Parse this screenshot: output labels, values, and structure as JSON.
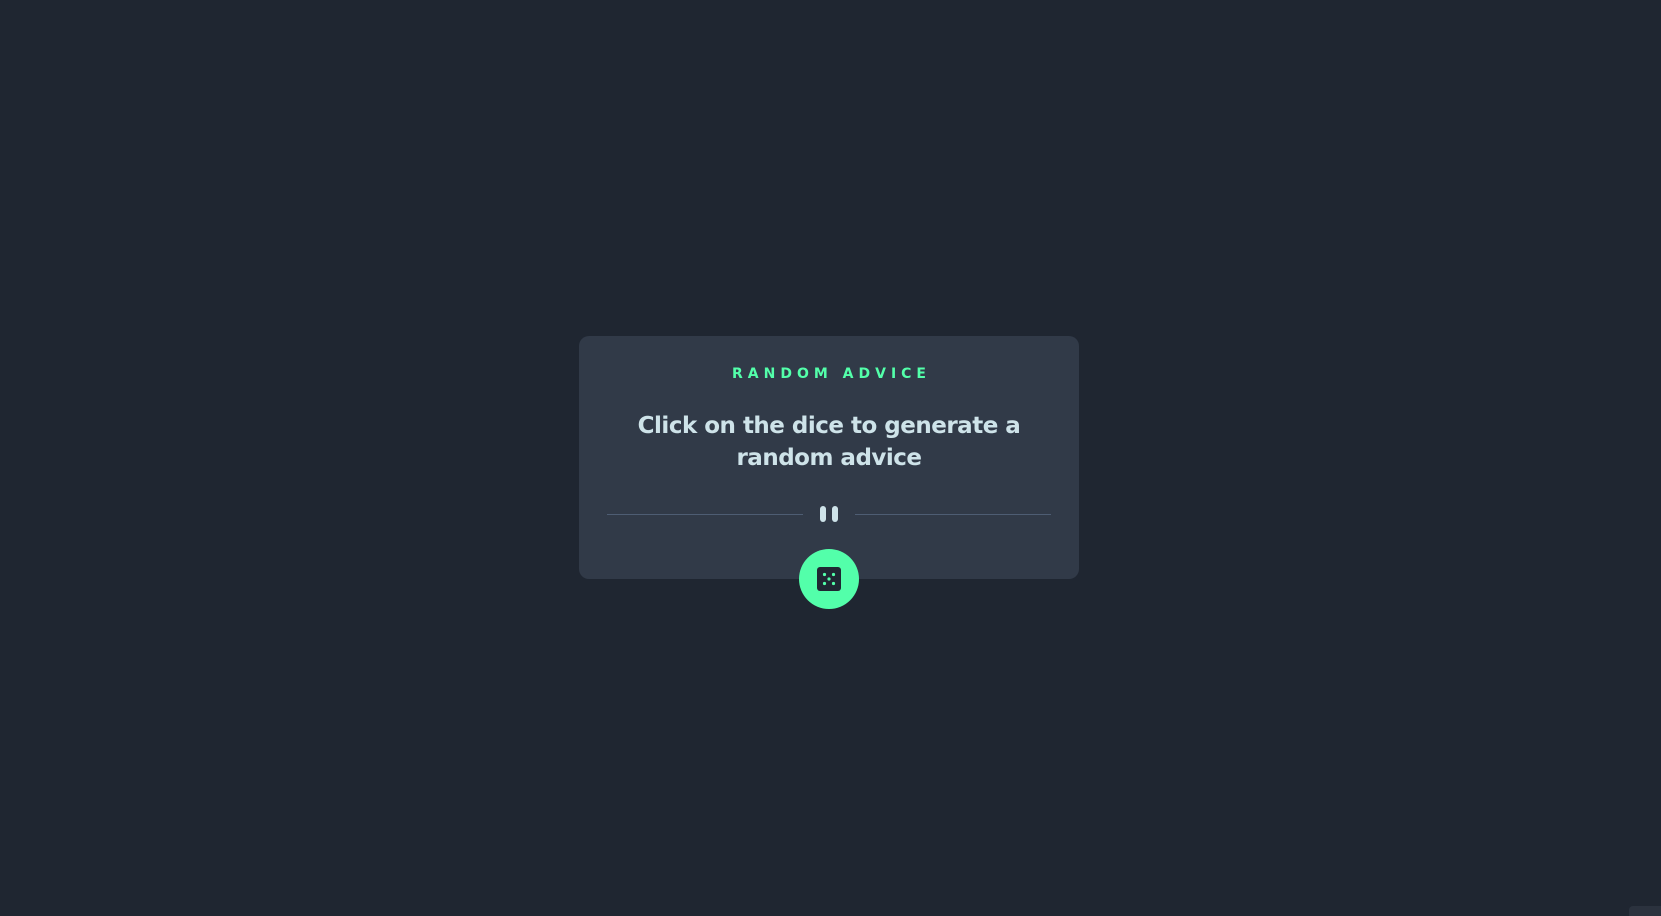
{
  "card": {
    "advice_label": "RANDOM ADVICE",
    "advice_text": "Click on the dice to generate a random advice"
  },
  "divider": {
    "icon": "pause-icon"
  },
  "dice_button": {
    "icon": "dice-icon",
    "aria_label": "Generate random advice"
  },
  "colors": {
    "background": "#1f2631",
    "card": "#313a48",
    "accent": "#53ffaa",
    "text": "#cee3e9",
    "divider": "#4e5d73"
  }
}
